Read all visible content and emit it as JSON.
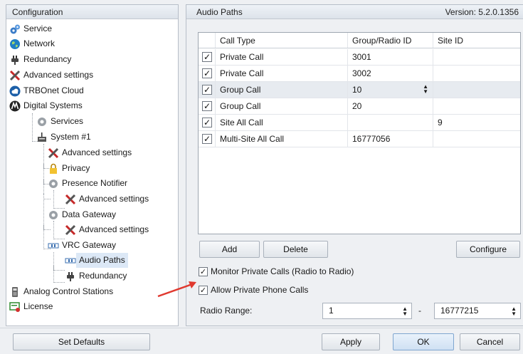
{
  "tree": {
    "header": "Configuration",
    "items": [
      {
        "label": "Service"
      },
      {
        "label": "Network"
      },
      {
        "label": "Redundancy"
      },
      {
        "label": "Advanced settings"
      },
      {
        "label": "TRBOnet Cloud"
      },
      {
        "label": "Digital Systems"
      },
      {
        "label": "Services"
      },
      {
        "label": "System #1"
      },
      {
        "label": "Advanced settings"
      },
      {
        "label": "Privacy"
      },
      {
        "label": "Presence Notifier"
      },
      {
        "label": "Advanced settings"
      },
      {
        "label": "Data Gateway"
      },
      {
        "label": "Advanced settings"
      },
      {
        "label": "VRC Gateway"
      },
      {
        "label": "Audio Paths"
      },
      {
        "label": "Redundancy"
      },
      {
        "label": "Analog Control Stations"
      },
      {
        "label": "License"
      }
    ]
  },
  "panel": {
    "title": "Audio Paths",
    "version": "Version: 5.2.0.1356"
  },
  "grid": {
    "columns": [
      "",
      "Call Type",
      "Group/Radio ID",
      "Site ID"
    ],
    "rows": [
      {
        "checked": true,
        "call_type": "Private Call",
        "group_id": "3001",
        "site_id": ""
      },
      {
        "checked": true,
        "call_type": "Private Call",
        "group_id": "3002",
        "site_id": ""
      },
      {
        "checked": true,
        "call_type": "Group Call",
        "group_id": "10",
        "site_id": ""
      },
      {
        "checked": true,
        "call_type": "Group Call",
        "group_id": "20",
        "site_id": ""
      },
      {
        "checked": true,
        "call_type": "Site All Call",
        "group_id": "",
        "site_id": "9"
      },
      {
        "checked": true,
        "call_type": "Multi-Site All Call",
        "group_id": "16777056",
        "site_id": ""
      }
    ]
  },
  "buttons": {
    "add": "Add",
    "delete": "Delete",
    "configure": "Configure",
    "set_defaults": "Set Defaults",
    "apply": "Apply",
    "ok": "OK",
    "cancel": "Cancel"
  },
  "options": {
    "monitor_private": {
      "label": "Monitor Private Calls (Radio to Radio)",
      "checked": true
    },
    "allow_phone": {
      "label": "Allow Private Phone Calls",
      "checked": true
    }
  },
  "radio_range": {
    "label": "Radio Range:",
    "from": "1",
    "separator": "-",
    "to": "16777215"
  },
  "colors": {
    "selection": "#dce8f6",
    "arrow": "#e0392f"
  }
}
